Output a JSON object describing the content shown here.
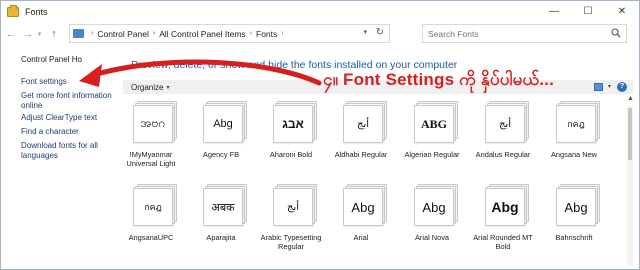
{
  "window": {
    "title": "Fonts",
    "controls": {
      "minimize": "—",
      "maximize": "☐",
      "close": "✕"
    }
  },
  "nav": {
    "back": "←",
    "forward": "→",
    "dropdown": "▾",
    "up": "↑",
    "breadcrumb": [
      "Control Panel",
      "All Control Panel Items",
      "Fonts"
    ],
    "separator": "›",
    "address_dropdown": "▾",
    "refresh": "↻",
    "search_placeholder": "Search Fonts"
  },
  "sidebar": {
    "home": "Control Panel Ho",
    "links": [
      "Font settings",
      "Get more font information online",
      "Adjust ClearType text",
      "Find a character",
      "Download fonts for all languages"
    ]
  },
  "main": {
    "subtitle": "Preview, delete, or show and hide the fonts installed on your computer",
    "organize": "Organize",
    "organize_caret": "▾",
    "view_caret": "▾",
    "help": "?",
    "scroll_up": "▲"
  },
  "fonts": [
    {
      "name": "!MyMyanmar Universal Light",
      "sample": "အဗဂ"
    },
    {
      "name": "Agency FB",
      "sample": "Abg"
    },
    {
      "name": "Aharoni Bold",
      "sample": "אבג"
    },
    {
      "name": "Aldhabi Regular",
      "sample": "أبج"
    },
    {
      "name": "Algerian Regular",
      "sample": "ABG"
    },
    {
      "name": "Andalus Regular",
      "sample": "أبج"
    },
    {
      "name": "Angsana New",
      "sample": "กคฎ"
    },
    {
      "name": "AngsanaUPC",
      "sample": "กคฎ"
    },
    {
      "name": "Aparajita",
      "sample": "अबक"
    },
    {
      "name": "Arabic Typesetting Regular",
      "sample": "أبج"
    },
    {
      "name": "Arial",
      "sample": "Abg"
    },
    {
      "name": "Arial Nova",
      "sample": "Abg"
    },
    {
      "name": "Arial Rounded MT Bold",
      "sample": "Abg"
    },
    {
      "name": "Bahnschrift",
      "sample": "Abg"
    }
  ],
  "annotation": {
    "text": "၄။ Font Settings ကို နှိပ်ပါမယ်...",
    "color": "#d81f1f"
  },
  "colors": {
    "link": "#1c3d6e",
    "subtitle": "#1e5b9e",
    "toolbar": "#f0f0f0"
  }
}
